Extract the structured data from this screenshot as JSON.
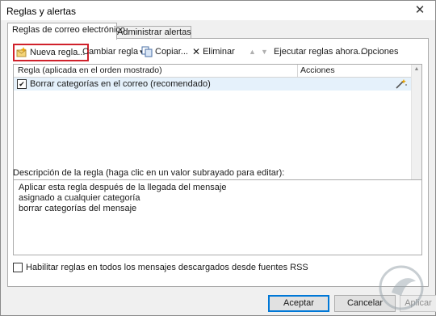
{
  "window": {
    "title": "Reglas y alertas",
    "close_glyph": "✕"
  },
  "tabs": [
    {
      "label": "Reglas de correo electrónico",
      "active": true
    },
    {
      "label": "Administrar alertas",
      "active": false
    }
  ],
  "toolbar": {
    "new_rule": {
      "label": "Nueva regla...",
      "icon": "new-rule-icon"
    },
    "change_rule": {
      "label": "Cambiar regla",
      "caret": "▾"
    },
    "copy": {
      "label": "Copiar...",
      "icon": "copy-icon"
    },
    "delete": {
      "label": "Eliminar",
      "glyph": "✕"
    },
    "move_up_glyph": "▲",
    "move_down_glyph": "▼",
    "run_rules": {
      "label": "Ejecutar reglas ahora..."
    },
    "options": {
      "label": "Opciones"
    }
  },
  "rules_table": {
    "columns": [
      "Regla (aplicada en el orden mostrado)",
      "Acciones"
    ],
    "rows": [
      {
        "checked": true,
        "check_glyph": "✔",
        "name": "Borrar categorías en el correo (recomendado)",
        "action_icon": "wand-icon"
      }
    ]
  },
  "description": {
    "label": "Descripción de la regla (haga clic en un valor subrayado para editar):",
    "lines": [
      "Aplicar esta regla después de la llegada del mensaje",
      "asignado a cualquier categoría",
      "borrar categorías del mensaje"
    ]
  },
  "rss_option": {
    "label": "Habilitar reglas en todos los mensajes descargados desde fuentes RSS",
    "checked": false
  },
  "buttons": {
    "ok": "Aceptar",
    "cancel": "Cancelar",
    "apply": "Aplicar"
  },
  "colors": {
    "highlight_border": "#d0212b",
    "selected_row": "#e5f1fb",
    "focus_button": "#0078d7"
  }
}
